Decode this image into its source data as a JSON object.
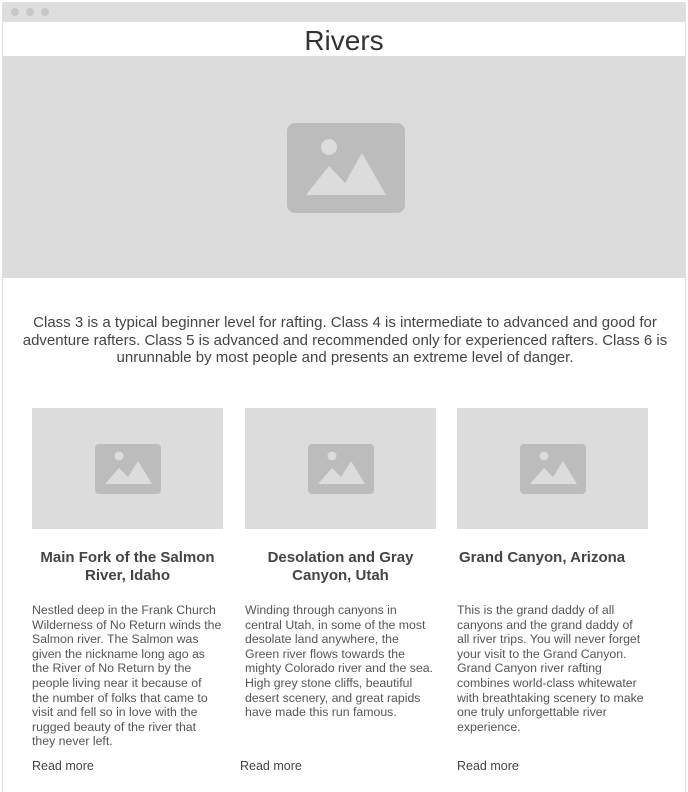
{
  "window": {
    "controls": [
      "close",
      "minimize",
      "maximize"
    ]
  },
  "page": {
    "title": "Rivers"
  },
  "hero": {
    "image_icon": "image-placeholder-icon"
  },
  "intro": {
    "text": "Class 3 is a typical beginner level for rafting. Class 4 is intermediate to advanced and good for adventure rafters. Class 5 is advanced and recommended only for experienced rafters. Class 6 is unrunnable by most people and presents an extreme level of danger."
  },
  "cards": [
    {
      "title": "Main Fork of the Salmon River, Idaho",
      "text": "Nestled deep in the Frank Church Wilderness of No Return winds the Salmon river. The Salmon was given the nickname long ago as the River of No Return by the people living near it because of the number of folks that came to visit and fell so in love with the rugged beauty of the river that they never left.",
      "link": "Read more",
      "image_icon": "image-placeholder-icon"
    },
    {
      "title": "Desolation and Gray Canyon, Utah",
      "text": "Winding through canyons in central Utah, in some of the most desolate land anywhere, the Green river flows towards the mighty Colorado river and the sea. High grey stone cliffs, beautiful desert scenery, and great rapids have made this run famous.",
      "link": "Read more",
      "image_icon": "image-placeholder-icon"
    },
    {
      "title": "Grand Canyon, Arizona",
      "text": "This is the grand daddy of all canyons and the grand daddy of all river trips. You will never forget your visit to the Grand Canyon. Grand Canyon river rafting combines world-class whitewater with breathtaking scenery to make one truly unforgettable river experience.",
      "link": "Read more",
      "image_icon": "image-placeholder-icon"
    }
  ],
  "colors": {
    "placeholder_bg": "#dcdcdc",
    "placeholder_icon": "#bcbcbc",
    "text": "#444444"
  }
}
